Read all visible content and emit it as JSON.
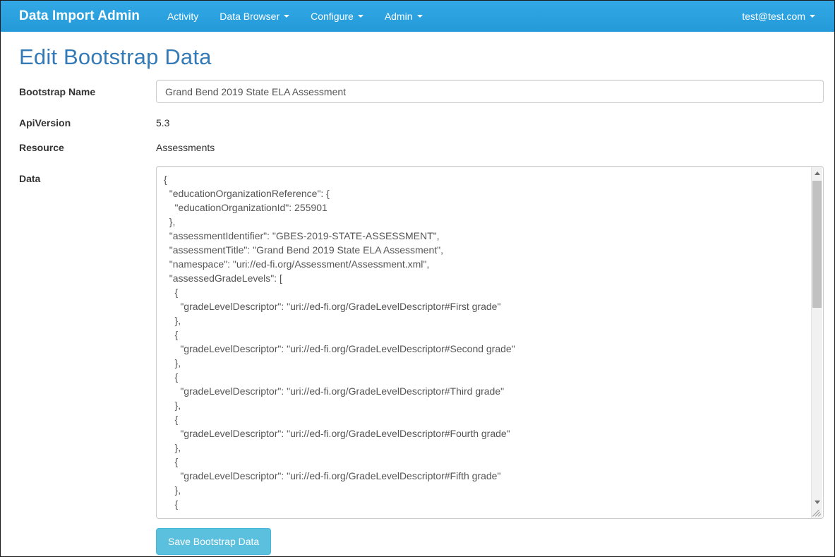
{
  "navbar": {
    "brand": "Data Import Admin",
    "items": [
      {
        "label": "Activity",
        "caret": false
      },
      {
        "label": "Data Browser",
        "caret": true
      },
      {
        "label": "Configure",
        "caret": true
      },
      {
        "label": "Admin",
        "caret": true
      }
    ],
    "user": "test@test.com",
    "user_caret": true,
    "background_color": "#29a0e0"
  },
  "page": {
    "title": "Edit Bootstrap Data",
    "title_color": "#337ab7"
  },
  "form": {
    "bootstrap_name_label": "Bootstrap Name",
    "bootstrap_name_value": "Grand Bend 2019 State ELA Assessment",
    "bootstrap_name_placeholder": "Bootstrap Name",
    "api_version_label": "ApiVersion",
    "api_version_value": "5.3",
    "resource_label": "Resource",
    "resource_value": "Assessments",
    "data_label": "Data",
    "data_value": "{\n  \"educationOrganizationReference\": {\n    \"educationOrganizationId\": 255901\n  },\n  \"assessmentIdentifier\": \"GBES-2019-STATE-ASSESSMENT\",\n  \"assessmentTitle\": \"Grand Bend 2019 State ELA Assessment\",\n  \"namespace\": \"uri://ed-fi.org/Assessment/Assessment.xml\",\n  \"assessedGradeLevels\": [\n    {\n      \"gradeLevelDescriptor\": \"uri://ed-fi.org/GradeLevelDescriptor#First grade\"\n    },\n    {\n      \"gradeLevelDescriptor\": \"uri://ed-fi.org/GradeLevelDescriptor#Second grade\"\n    },\n    {\n      \"gradeLevelDescriptor\": \"uri://ed-fi.org/GradeLevelDescriptor#Third grade\"\n    },\n    {\n      \"gradeLevelDescriptor\": \"uri://ed-fi.org/GradeLevelDescriptor#Fourth grade\"\n    },\n    {\n      \"gradeLevelDescriptor\": \"uri://ed-fi.org/GradeLevelDescriptor#Fifth grade\"\n    },\n    {\n      \"gradeLevelDescriptor\": \"uri://ed-fi.org/GradeLevelDescriptor#Sixth grade\"\n    },"
  },
  "actions": {
    "save_label": "Save Bootstrap Data",
    "save_color": "#5bc0de"
  },
  "scrollbar": {
    "up_arrow_icon": "triangle-up-icon",
    "down_arrow_icon": "triangle-down-icon",
    "resize_grip_icon": "resize-grip-icon"
  }
}
